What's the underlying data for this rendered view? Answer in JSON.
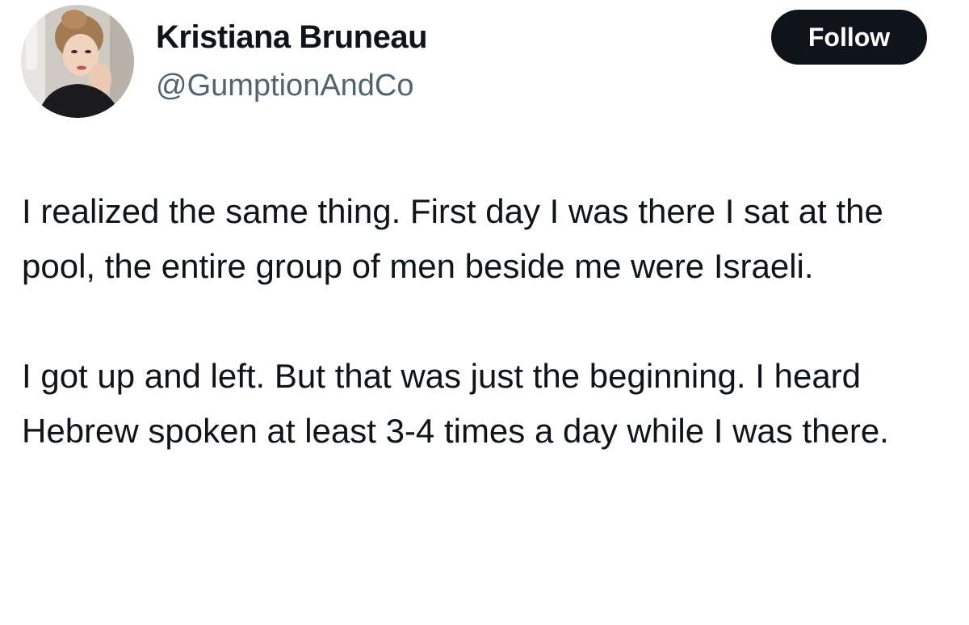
{
  "author": {
    "display_name": "Kristiana Bruneau",
    "handle": "@GumptionAndCo",
    "avatar_icon": "profile-photo"
  },
  "actions": {
    "follow_label": "Follow"
  },
  "tweet": {
    "paragraphs": [
      "I realized the same thing. First day I was there I sat at the pool, the entire group of men beside me were Israeli.",
      "I got up and left. But that was just the beginning. I heard Hebrew spoken at least 3-4 times a day while I was there."
    ]
  },
  "colors": {
    "background": "#ffffff",
    "text_primary": "#0f1419",
    "text_secondary": "#536471",
    "button_bg": "#0f1419",
    "button_text": "#ffffff"
  }
}
